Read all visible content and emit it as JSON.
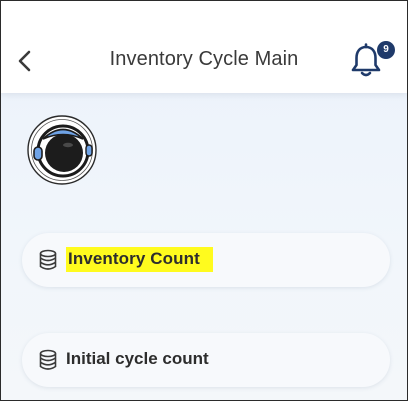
{
  "header": {
    "title": "Inventory Cycle Main",
    "back_icon": "chevron-left-icon",
    "notification_icon": "bell-icon",
    "notification_count": "9"
  },
  "profile": {
    "avatar_icon": "astronaut-avatar"
  },
  "menu": {
    "items": [
      {
        "label": "Inventory Count",
        "icon": "database-icon",
        "highlighted": true
      },
      {
        "label": "Initial cycle count",
        "icon": "database-icon",
        "highlighted": false
      }
    ]
  },
  "colors": {
    "badge": "#1f3a6a",
    "highlight": "#fffb1e",
    "bell": "#1f3a6a",
    "background": "#eef4fb"
  }
}
